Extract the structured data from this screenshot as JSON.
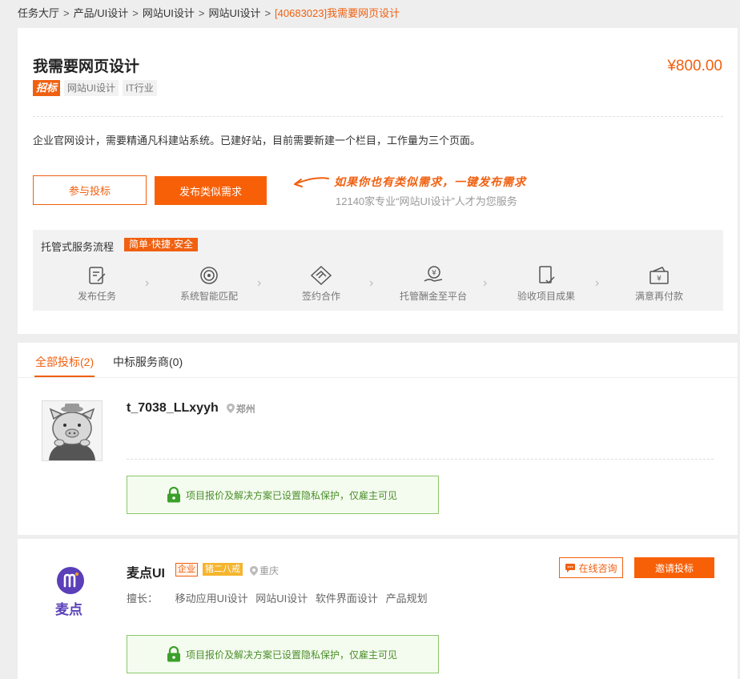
{
  "breadcrumb": {
    "items": [
      "任务大厅",
      "产品/UI设计",
      "网站UI设计",
      "网站UI设计"
    ],
    "current": "[40683023]我需要网页设计",
    "separator": ">"
  },
  "task": {
    "title": "我需要网页设计",
    "price": "¥800.00",
    "mode_tag": "招标",
    "tags": [
      "网站UI设计",
      "IT行业"
    ],
    "description": "企业官网设计，需要精通凡科建站系统。已建好站，目前需要新建一个栏目，工作量为三个页面。",
    "bid_button": "参与投标",
    "publish_button": "发布类似需求",
    "promo_main": "如果你也有类似需求，一键发布需求",
    "promo_sub": "12140家专业“网站UI设计”人才为您服务"
  },
  "flow": {
    "title": "托管式服务流程",
    "badge": "简单·快捷·安全",
    "steps": [
      {
        "label": "发布任务",
        "icon": "edit-doc-icon"
      },
      {
        "label": "系统智能匹配",
        "icon": "target-icon"
      },
      {
        "label": "签约合作",
        "icon": "handshake-icon"
      },
      {
        "label": "托管酬金至平台",
        "icon": "yen-hand-icon"
      },
      {
        "label": "验收项目成果",
        "icon": "check-doc-icon"
      },
      {
        "label": "满意再付款",
        "icon": "wallet-icon"
      }
    ]
  },
  "bids": {
    "tabs": [
      {
        "label": "全部投标(2)",
        "active": true
      },
      {
        "label": "中标服务商(0)",
        "active": false
      }
    ],
    "bidder1": {
      "name": "t_7038_LLxyyh",
      "location": "郑州",
      "privacy": "项目报价及解决方案已设置隐私保护，仅雇主可见"
    },
    "bidder2": {
      "name": "麦点UI",
      "logo_text": "麦点",
      "badge_type": "企业",
      "badge_level": "猪二八戒",
      "location": "重庆",
      "skills_label": "擅长：",
      "skills": [
        "移动应用UI设计",
        "网站UI设计",
        "软件界面设计",
        "产品规划"
      ],
      "consult_button": "在线咨询",
      "invite_button": "邀请投标",
      "privacy": "项目报价及解决方案已设置隐私保护，仅雇主可见"
    }
  },
  "colors": {
    "accent": "#f06010",
    "privacy_green": "#4a8f2a",
    "logo_purple": "#5a3fb8"
  }
}
